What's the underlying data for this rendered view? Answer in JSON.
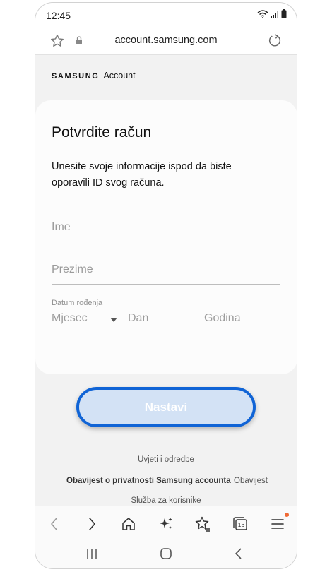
{
  "status_bar": {
    "time": "12:45"
  },
  "url_bar": {
    "url": "account.samsung.com"
  },
  "brand": {
    "samsung": "SAMSUNG",
    "account": "Account"
  },
  "form": {
    "title": "Potvrdite račun",
    "description": "Unesite svoje informacije ispod da biste oporavili ID svog računa.",
    "first_name_placeholder": "Ime",
    "last_name_placeholder": "Prezime",
    "dob_label": "Datum rođenja",
    "month_placeholder": "Mjesec",
    "day_placeholder": "Dan",
    "year_placeholder": "Godina",
    "continue_label": "Nastavi"
  },
  "footer": {
    "terms": "Uvjeti i odredbe",
    "privacy": "Obavijest o privatnosti Samsung accounta",
    "notice": "Obavijest",
    "support": "Služba za korisnike"
  },
  "browser_toolbar": {
    "tab_count": "16"
  },
  "colors": {
    "accent": "#1064d6",
    "button_fill": "#d3e2f5",
    "notification_dot": "#f06a35"
  }
}
